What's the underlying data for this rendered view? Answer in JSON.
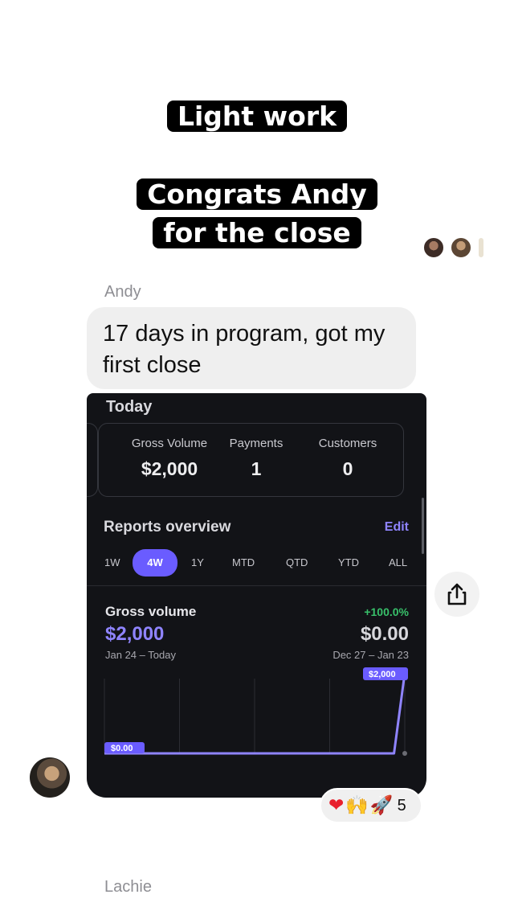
{
  "captions": [
    "Light work",
    "Congrats Andy",
    "for the close"
  ],
  "message": {
    "sender": "Andy",
    "text": "17 days in program, got my first close"
  },
  "card": {
    "section_title": "Today",
    "stats": [
      {
        "label": "Gross Volume",
        "value": "$2,000"
      },
      {
        "label": "Payments",
        "value": "1"
      },
      {
        "label": "Customers",
        "value": "0"
      }
    ],
    "reports_title": "Reports overview",
    "edit_label": "Edit",
    "tabs": [
      "1W",
      "4W",
      "1Y",
      "MTD",
      "QTD",
      "YTD",
      "ALL"
    ],
    "active_tab": "4W",
    "gross_volume": {
      "title": "Gross volume",
      "value": "$2,000",
      "range": "Jan 24 – Today",
      "change": "+100.0%",
      "previous_value": "$0.00",
      "previous_range": "Dec 27 – Jan 23"
    }
  },
  "chart_data": {
    "type": "line",
    "title": "Gross volume",
    "y_min_label": "$0.00",
    "y_max_label": "$2,000",
    "series": [
      {
        "values": [
          0,
          0,
          0,
          0,
          0,
          0,
          0,
          0,
          0,
          0,
          0,
          0,
          0,
          0,
          0,
          0,
          0,
          0,
          0,
          0,
          0,
          0,
          0,
          0,
          0,
          0,
          0,
          0,
          2000
        ]
      }
    ],
    "ylim": [
      0,
      2000
    ],
    "grid": true,
    "accent": "#8f84ff"
  },
  "reactions": {
    "emojis": [
      "❤",
      "🙌",
      "🚀"
    ],
    "count": "5"
  },
  "next_sender": "Lachie",
  "colors": {
    "accent": "#6a5cff",
    "positive": "#38c06a",
    "card_bg": "#121317"
  }
}
